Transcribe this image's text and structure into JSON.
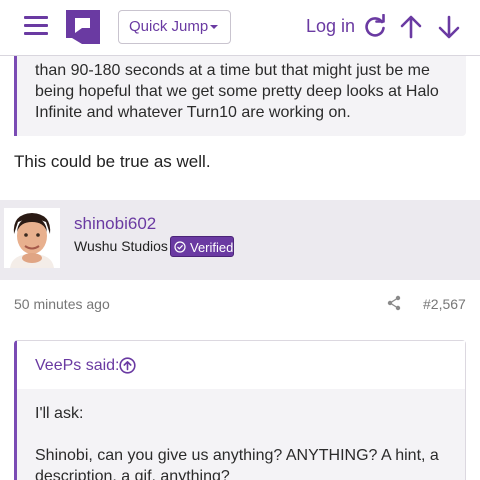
{
  "header": {
    "menu_icon": "hamburger-icon",
    "logo_icon": "resetera-logo",
    "quick_jump_label": "Quick Jump",
    "login_label": "Log in",
    "refresh_icon": "refresh-icon",
    "up_icon": "arrow-up-icon",
    "down_icon": "arrow-down-icon",
    "accent_color": "#6a3aa2"
  },
  "post1": {
    "quote_lines": [
      "than 90-180 seconds at a time but that might just be me",
      "being hopeful that we get some pretty deep looks at Halo",
      "Infinite and whatever Turn10 are working on."
    ],
    "reply": "This could be true as well."
  },
  "user": {
    "name": "shinobi602",
    "title": "Wushu Studios",
    "badge": "Verified"
  },
  "post2": {
    "time": "50 minutes ago",
    "number": "#2,567",
    "quote_author": "VeePs said:",
    "quote_lines": [
      "I'll ask:",
      "Shinobi, can you give us anything? ANYTHING? A hint, a",
      "description, a gif, anything?"
    ]
  }
}
